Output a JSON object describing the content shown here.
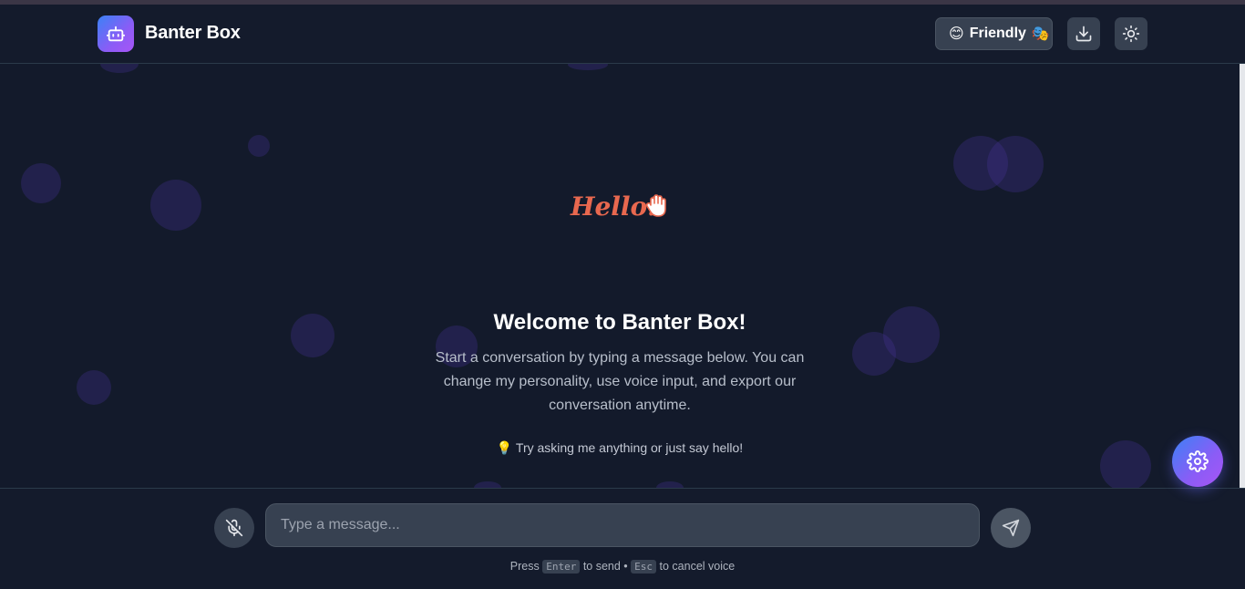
{
  "header": {
    "brand": "Banter Box",
    "personality": {
      "emoji_left": "😊",
      "label": "Friendly",
      "emoji_right": "🎭"
    },
    "export_icon": "download-icon",
    "theme_icon": "sun-icon"
  },
  "welcome": {
    "greeting": "Hello!",
    "greeting_emoji": "👋",
    "title": "Welcome to Banter Box!",
    "description": "Start a conversation by typing a message below. You can change my personality, use voice input, and export our conversation anytime.",
    "tip_emoji": "💡",
    "tip": "Try asking me anything or just say hello!"
  },
  "composer": {
    "placeholder": "Type a message...",
    "value": "",
    "mic_icon": "mic-off-icon",
    "send_icon": "send-icon",
    "hint": {
      "press": "Press",
      "key_send": "Enter",
      "to_send": "to send •",
      "key_cancel": "Esc",
      "to_cancel": "to cancel voice"
    }
  },
  "fab_icon": "settings-icon",
  "colors": {
    "background": "#131a2b",
    "accent_start": "#3b82f6",
    "accent_end": "#a855f7",
    "greeting": "#e8684f"
  }
}
